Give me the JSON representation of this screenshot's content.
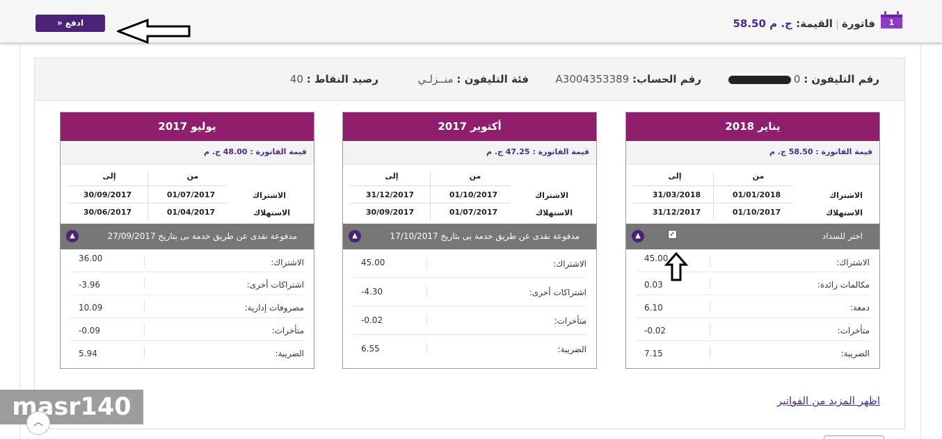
{
  "header": {
    "step_number": "1",
    "invoice_label": "فاتورة",
    "value_label": "القيمة:",
    "value_amount": "ج. م 58.50",
    "pay_button": "ادفع"
  },
  "account_info": {
    "phone_label": "رقم التليفون :",
    "phone_value": "0",
    "account_label": "رقم الحساب:",
    "account_value": "A3004353389",
    "category_label": "فئة التليفون :",
    "category_value": "منــزلـي",
    "points_label": "رصيد النقاط :",
    "points_value": "40"
  },
  "bills": [
    {
      "month": "يناير 2018",
      "total": "قيمة الفاتورة : 58.50 ج. م",
      "col_from": "من",
      "col_to": "إلى",
      "sub_label": "الاشتراك",
      "sub_from": "01/01/2018",
      "sub_to": "31/03/2018",
      "cons_label": "الاستهلاك",
      "cons_from": "01/10/2017",
      "cons_to": "31/12/2017",
      "status": "اختر للسداد",
      "checkbox": "✓",
      "items": [
        {
          "label": "الاشتراك:",
          "value": "45.00"
        },
        {
          "label": "مكالمات زائدة:",
          "value": "0.03"
        },
        {
          "label": "دمغة:",
          "value": "6.10"
        },
        {
          "label": "متأخرات:",
          "value": "-0.02"
        },
        {
          "label": "الضريبة:",
          "value": "7.15"
        }
      ]
    },
    {
      "month": "أكتوبر 2017",
      "total": "قيمة الفاتورة : 47.25 ج. م",
      "col_from": "من",
      "col_to": "إلى",
      "sub_label": "الاشتراك",
      "sub_from": "01/10/2017",
      "sub_to": "31/12/2017",
      "cons_label": "الاستهلاك",
      "cons_from": "01/07/2017",
      "cons_to": "30/09/2017",
      "status": "مدفوعة نقدى عن طريق خدمة بى بتاريخ 17/10/2017",
      "items": [
        {
          "label": "الاشتراك:",
          "value": "45.00"
        },
        {
          "label": "اشتراكات أخرى:",
          "value": "-4.30"
        },
        {
          "label": "متأخرات:",
          "value": "-0.02"
        },
        {
          "label": "الضريبة:",
          "value": "6.55"
        }
      ]
    },
    {
      "month": "يوليو 2017",
      "total": "قيمة الفاتورة : 48.00 ج. م",
      "col_from": "من",
      "col_to": "إلى",
      "sub_label": "الاشتراك",
      "sub_from": "01/07/2017",
      "sub_to": "30/09/2017",
      "cons_label": "الاستهلاك",
      "cons_from": "01/04/2017",
      "cons_to": "30/06/2017",
      "status": "مدفوعة نقدى عن طريق خدمة بى بتاريخ 27/09/2017",
      "items": [
        {
          "label": "الاشتراك:",
          "value": "36.00"
        },
        {
          "label": "اشتراكات أخرى:",
          "value": "-3.96"
        },
        {
          "label": "مصروفات إدارية:",
          "value": "10.09"
        },
        {
          "label": "متأخرات:",
          "value": "-0.09"
        },
        {
          "label": "الضريبة:",
          "value": "5.94"
        }
      ]
    }
  ],
  "more_link": "اظهر المزيد من الفواتير",
  "watermark": "masr140",
  "icons": {
    "chevron": "chevron-up-icon",
    "scroll": "scroll-up-icon"
  }
}
